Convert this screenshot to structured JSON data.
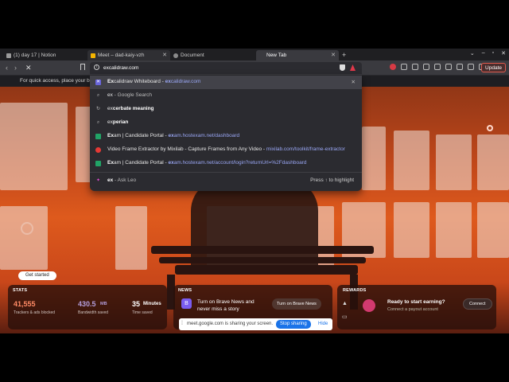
{
  "tabs": [
    {
      "label": "(1) day 17 | Notion",
      "color": "#9a9a9a"
    },
    {
      "label": "Meet – dad-kaiy-vzh",
      "color": "#f4b400"
    },
    {
      "label": "Document",
      "color": "#8a8a8a"
    },
    {
      "label": "New Tab",
      "color": "#bbbbbb"
    }
  ],
  "toolbar": {
    "omnibox_value": "excalidraw.com",
    "update_label": "Update"
  },
  "notice_text": "For quick access, place your boo",
  "suggestions": [
    {
      "bold": "Ex",
      "rest": "calidraw Whiteboard - ",
      "url_bold": "ex",
      "url_rest": "calidraw.com",
      "icon_color": "#6965db"
    },
    {
      "bold": "ex",
      "rest": " - Google Search",
      "url_bold": "",
      "url_rest": "",
      "icon_color": ""
    },
    {
      "bold": "ex",
      "rest": "cerbate meaning",
      "url_bold": "",
      "url_rest": "",
      "icon_color": ""
    },
    {
      "bold": "ex",
      "rest": "perian",
      "url_bold": "",
      "url_rest": "",
      "icon_color": ""
    },
    {
      "bold": "Ex",
      "rest": "am | Candidate Portal - ",
      "url_bold": "ex",
      "url_rest": "am.hostexam.net/dashboard",
      "icon_color": "#21a366"
    },
    {
      "bold": "",
      "rest": "Video Frame Extractor by Mixilab - Capture Frames from Any Video - ",
      "url_bold": "",
      "url_rest": "mixilab.com/toolkit/frame-extractor",
      "icon_color": "#e53935"
    },
    {
      "bold": "Ex",
      "rest": "am | Candidate Portal - ",
      "url_bold": "ex",
      "url_rest": "am.hostexam.net/account/login?returnUrl=%2Fdashboard",
      "icon_color": "#21a366"
    },
    {
      "bold": "ex",
      "rest": " - Ask Leo",
      "url_bold": "",
      "url_rest": "",
      "icon_color": "#e04bd0"
    }
  ],
  "press_hint": "Press ↑ to highlight",
  "get_started": "Get started",
  "stats": {
    "title": "STATS",
    "trackers_value": "41,555",
    "trackers_label": "Trackers & ads blocked",
    "bandwidth_value": "430.5",
    "bandwidth_unit": "MB",
    "bandwidth_label": "Bandwidth saved",
    "time_value": "35",
    "time_unit": "Minutes",
    "time_label": "Time saved"
  },
  "news": {
    "title": "NEWS",
    "text": "Turn on Brave News and never miss a story",
    "button": "Turn on Brave News"
  },
  "share": {
    "text": "meet.google.com is sharing your screen.",
    "stop": "Stop sharing",
    "hide": "Hide"
  },
  "rewards": {
    "title": "REWARDS",
    "heading": "Ready to start earning?",
    "sub": "Connect a payout account",
    "button": "Connect"
  },
  "colors": {
    "accent": "#de5a1d",
    "stats_orange": "#ff8a65",
    "stats_purple": "#b39ddb",
    "link": "#9aa7f5"
  }
}
